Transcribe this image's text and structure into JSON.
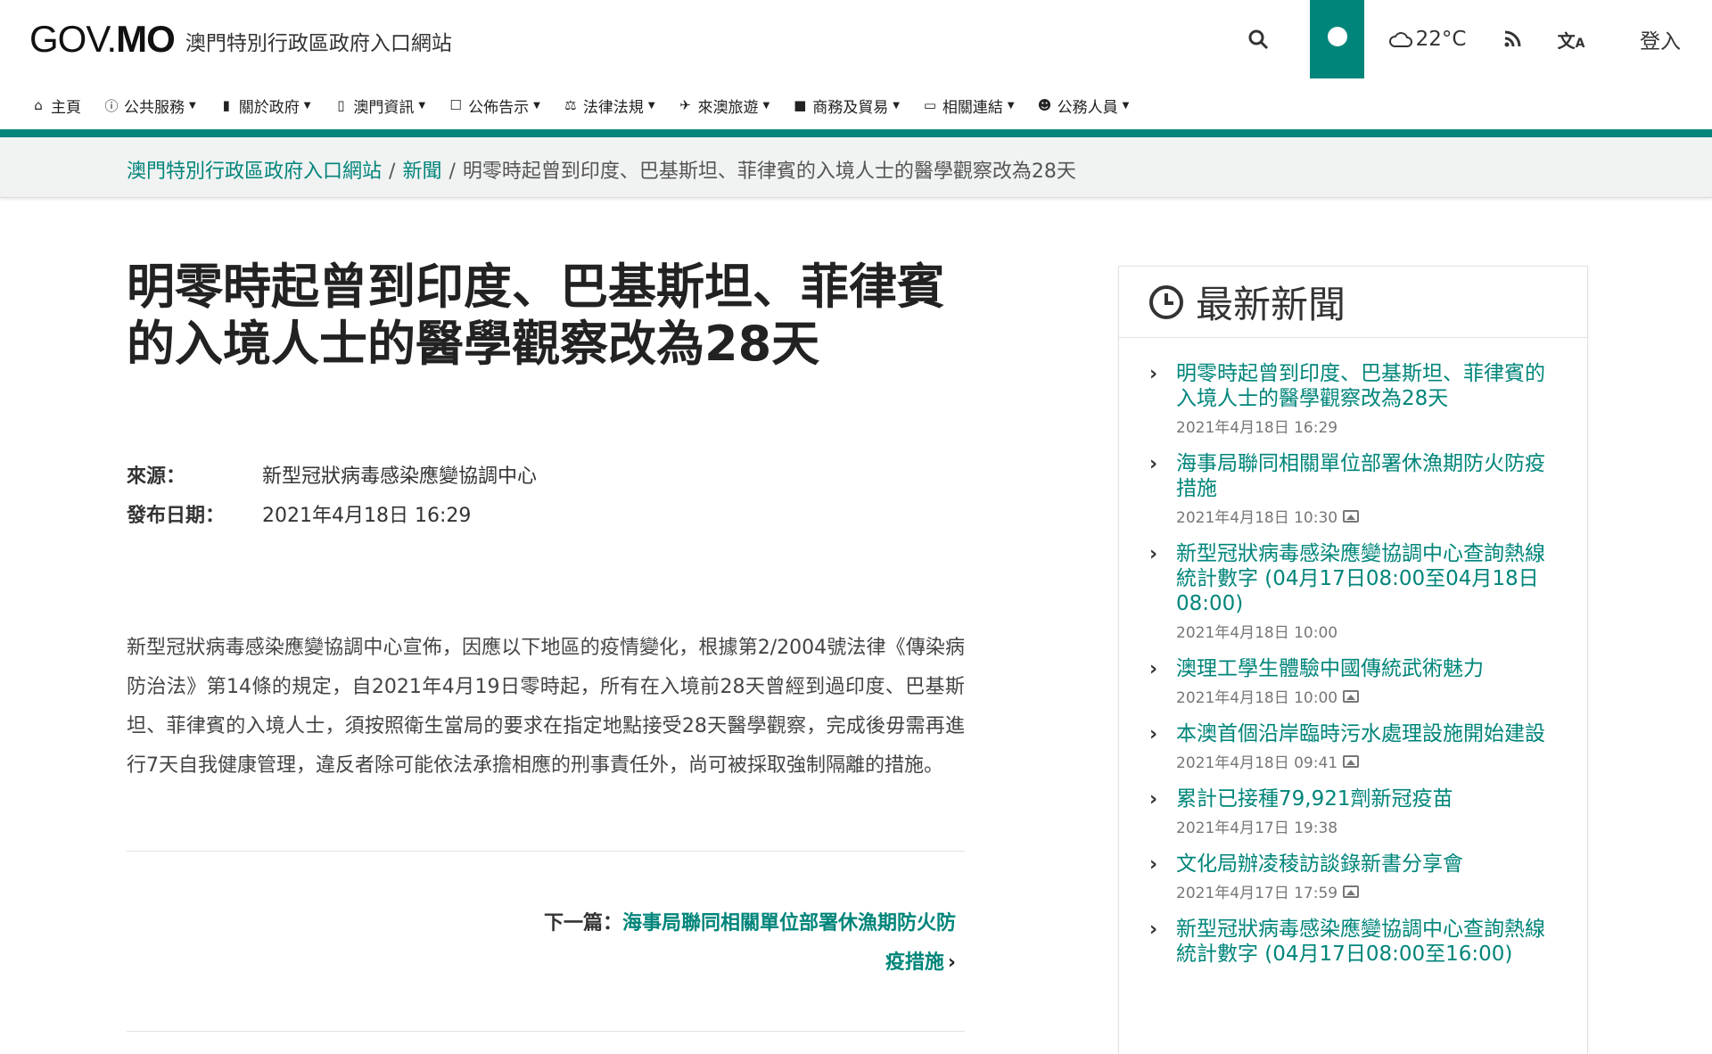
{
  "header": {
    "logo_main": "GOV.",
    "logo_bold": "MO",
    "logo_sub": "澳門特別行政區政府入口網站",
    "weather": "22°C",
    "login_label": "登入"
  },
  "nav": {
    "items": [
      {
        "label": "主頁",
        "icon": "home-icon"
      },
      {
        "label": "公共服務",
        "icon": "info-icon"
      },
      {
        "label": "關於政府",
        "icon": "book-icon"
      },
      {
        "label": "澳門資訊",
        "icon": "map-icon"
      },
      {
        "label": "公佈告示",
        "icon": "notice-icon"
      },
      {
        "label": "法律法規",
        "icon": "scale-icon"
      },
      {
        "label": "來澳旅遊",
        "icon": "plane-icon"
      },
      {
        "label": "商務及貿易",
        "icon": "briefcase-icon"
      },
      {
        "label": "相關連結",
        "icon": "folder-icon"
      },
      {
        "label": "公務人員",
        "icon": "users-icon"
      }
    ]
  },
  "breadcrumb": {
    "home": "澳門特別行政區政府入口網站",
    "section": "新聞",
    "current": "明零時起曾到印度、巴基斯坦、菲律賓的入境人士的醫學觀察改為28天"
  },
  "article": {
    "title": "明零時起曾到印度、巴基斯坦、菲律賓的入境人士的醫學觀察改為28天",
    "source_label": "來源：",
    "source_value": "新型冠狀病毒感染應變協調中心",
    "date_label": "發布日期：",
    "date_value": "2021年4月18日 16:29",
    "body": "新型冠狀病毒感染應變協調中心宣佈，因應以下地區的疫情變化，根據第2/2004號法律《傳染病防治法》第14條的規定，自2021年4月19日零時起，所有在入境前28天曾經到過印度、巴基斯坦、菲律賓的入境人士，須按照衛生當局的要求在指定地點接受28天醫學觀察，完成後毋需再進行7天自我健康管理，違反者除可能依法承擔相應的刑事責任外，尚可被採取強制隔離的措施。",
    "next_label": "下一篇：",
    "next_title": "海事局聯同相關單位部署休漁期防火防疫措施"
  },
  "sidebar": {
    "title": "最新新聞",
    "items": [
      {
        "title": "明零時起曾到印度、巴基斯坦、菲律賓的入境人士的醫學觀察改為28天",
        "date": "2021年4月18日 16:29",
        "has_image": false
      },
      {
        "title": "海事局聯同相關單位部署休漁期防火防疫措施",
        "date": "2021年4月18日 10:30",
        "has_image": true
      },
      {
        "title": "新型冠狀病毒感染應變協調中心查詢熱線統計數字 (04月17日08:00至04月18日08:00)",
        "date": "2021年4月18日 10:00",
        "has_image": false
      },
      {
        "title": "澳理工學生體驗中國傳統武術魅力",
        "date": "2021年4月18日 10:00",
        "has_image": true
      },
      {
        "title": "本澳首個沿岸臨時污水處理設施開始建設",
        "date": "2021年4月18日 09:41",
        "has_image": true
      },
      {
        "title": "累計已接種79,921劑新冠疫苗",
        "date": "2021年4月17日 19:38",
        "has_image": false
      },
      {
        "title": "文化局辦凌稜訪談錄新書分享會",
        "date": "2021年4月17日 17:59",
        "has_image": true
      },
      {
        "title": "新型冠狀病毒感染應變協調中心查詢熱線統計數字 (04月17日08:00至16:00)",
        "date": "",
        "has_image": false
      }
    ]
  }
}
